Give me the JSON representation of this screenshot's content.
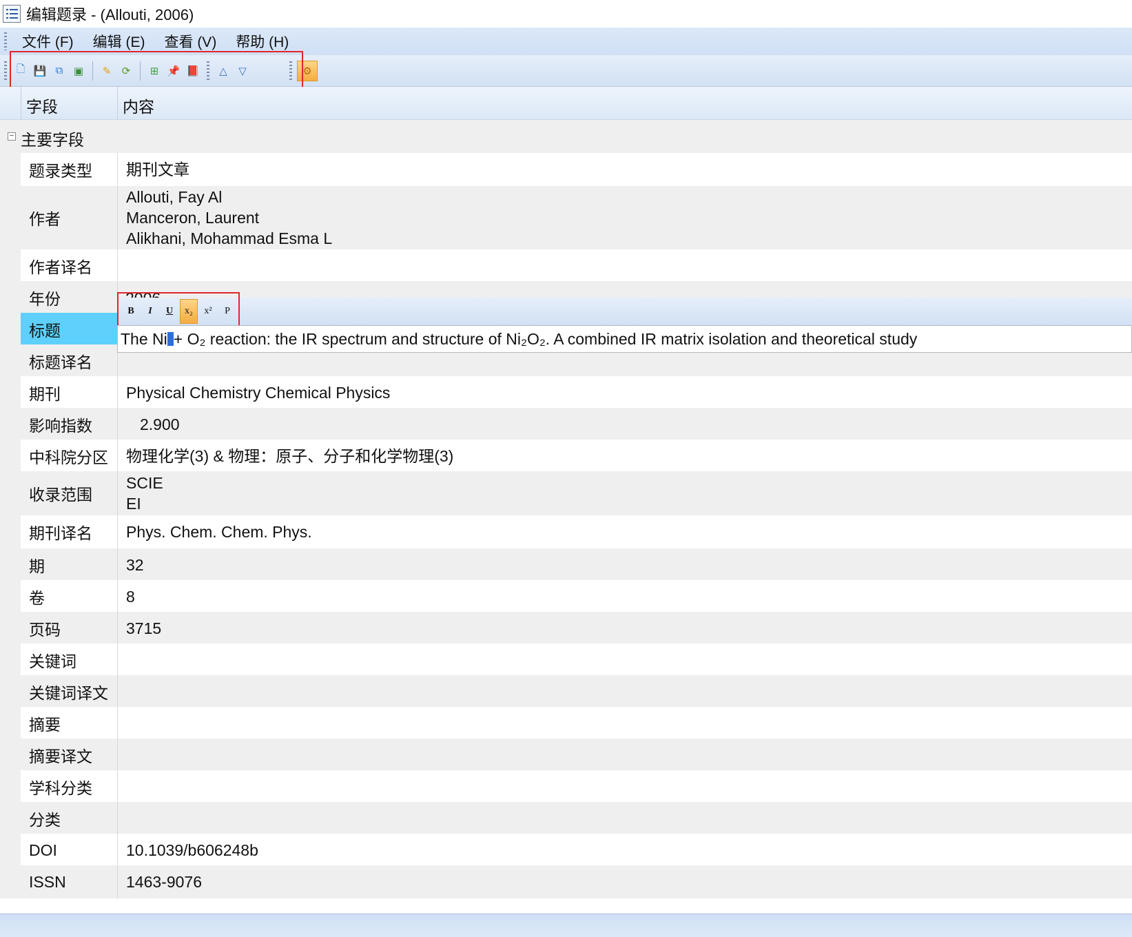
{
  "window": {
    "title": "编辑题录 - (Allouti, 2006)",
    "app_icon": "list-icon"
  },
  "menu": {
    "items": [
      "文件 (F)",
      "编辑 (E)",
      "查看 (V)",
      "帮助 (H)"
    ]
  },
  "toolbar": {
    "buttons": [
      {
        "icon": "new-doc-icon",
        "glyph": "🗋",
        "color": "#2f7bd6"
      },
      {
        "icon": "save-icon",
        "glyph": "💾",
        "color": "#2f7bd6"
      },
      {
        "icon": "save-copy-icon",
        "glyph": "⧉",
        "color": "#2f7bd6"
      },
      {
        "icon": "save-close-icon",
        "glyph": "▣",
        "color": "#3a8f3a"
      },
      {
        "icon": "clean-icon",
        "glyph": "✎",
        "color": "#e0a010"
      },
      {
        "icon": "update-icon",
        "glyph": "⟳",
        "color": "#5a9a20"
      },
      {
        "icon": "grid-icon",
        "glyph": "⊞",
        "color": "#40a040"
      },
      {
        "icon": "pin-icon",
        "glyph": "📌",
        "color": "#2f6fb6"
      },
      {
        "icon": "book-icon",
        "glyph": "📕",
        "color": "#6a4a20"
      },
      {
        "icon": "arrow-up-icon",
        "glyph": "△",
        "color": "#3a6fb6"
      },
      {
        "icon": "arrow-down-icon",
        "glyph": "▽",
        "color": "#3a6fb6"
      },
      {
        "icon": "settings-icon",
        "glyph": "⚙",
        "color": "#b86a10"
      }
    ]
  },
  "grid": {
    "columns": [
      "字段",
      "内容"
    ],
    "category": "主要字段",
    "category_toggle": "−",
    "rows": [
      {
        "field": "题录类型",
        "value": [
          "期刊文章"
        ]
      },
      {
        "field": "作者",
        "value": [
          "Allouti, Fay Al",
          "Manceron, Laurent",
          "Alikhani, Mohammad Esma L"
        ]
      },
      {
        "field": "作者译名",
        "value": [
          ""
        ]
      },
      {
        "field": "年份",
        "value": [
          "2006"
        ]
      },
      {
        "field": "标题",
        "value": [
          ""
        ]
      },
      {
        "field": "标题译名",
        "value": [
          ""
        ]
      },
      {
        "field": "期刊",
        "value": [
          "Physical Chemistry Chemical Physics"
        ]
      },
      {
        "field": "影响指数",
        "value": [
          "2.900"
        ]
      },
      {
        "field": "中科院分区",
        "value": [
          "物理化学(3) & 物理：原子、分子和化学物理(3)"
        ]
      },
      {
        "field": "收录范围",
        "value": [
          "SCIE",
          "EI"
        ]
      },
      {
        "field": "期刊译名",
        "value": [
          "Phys. Chem. Chem. Phys."
        ]
      },
      {
        "field": "期",
        "value": [
          "32"
        ]
      },
      {
        "field": "卷",
        "value": [
          "8"
        ]
      },
      {
        "field": "页码",
        "value": [
          "3715"
        ]
      },
      {
        "field": "关键词",
        "value": [
          ""
        ]
      },
      {
        "field": "关键词译文",
        "value": [
          ""
        ]
      },
      {
        "field": "摘要",
        "value": [
          ""
        ]
      },
      {
        "field": "摘要译文",
        "value": [
          ""
        ]
      },
      {
        "field": "学科分类",
        "value": [
          ""
        ]
      },
      {
        "field": "分类",
        "value": [
          ""
        ]
      },
      {
        "field": "DOI",
        "value": [
          "10.1039/b606248b"
        ]
      },
      {
        "field": "ISSN",
        "value": [
          "1463-9076"
        ]
      }
    ]
  },
  "editor": {
    "format_buttons": [
      "B",
      "I",
      "U",
      "x₂",
      "x²",
      "P"
    ],
    "title_before": "The Ni",
    "title_after": " + O₂ reaction: the IR spectrum and structure of Ni₂O₂. A combined IR matrix isolation and theoretical study"
  },
  "colors": {
    "selected_row": "#5ed0fb",
    "highlight_box": "#e0262c",
    "active_button": "#f6ac42"
  }
}
